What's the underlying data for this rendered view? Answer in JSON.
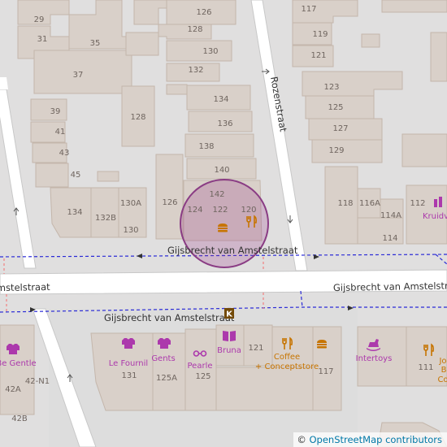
{
  "streets": {
    "rozenstraat": "Rozenstraat",
    "gijsbrecht_upper": "Gijsbrecht van Amstelstraat",
    "gijsbrecht_lower": "Gijsbrecht van Amstelstraat",
    "gijsbrecht_right": "Gijsbrecht van Amstelstraat",
    "amstelstraat_left": "Amstelstraat"
  },
  "house_numbers": {
    "n29": "29",
    "n31": "31",
    "n35": "35",
    "n37": "37",
    "n39": "39",
    "n41": "41",
    "n43": "43",
    "n45": "45",
    "n134a": "134",
    "n132b": "132B",
    "n130a": "130A",
    "n130": "130",
    "n126a": "126",
    "n128a": "128",
    "n126": "126",
    "n128": "128",
    "n130b": "130",
    "n132": "132",
    "n134": "134",
    "n136": "136",
    "n138": "138",
    "n140": "140",
    "n142": "142",
    "n124": "124",
    "n122": "122",
    "n120": "120",
    "n117": "117",
    "n119": "119",
    "n121": "121",
    "n123": "123",
    "n125": "125",
    "n127": "127",
    "n129": "129",
    "n118": "118",
    "n116a": "116A",
    "n114a": "114A",
    "n114": "114",
    "n112": "112",
    "n121b": "121",
    "n117b": "117",
    "n111": "111",
    "n131": "131",
    "n125a": "125A",
    "n42n1": "42-N1",
    "n42a": "42A",
    "n42b": "42B"
  },
  "pois": {
    "le_fournil": "Le Fournil",
    "gents": "Gents",
    "pearle": "Pearle",
    "bruna": "Bruna",
    "coffee_1": "Coffee",
    "coffee_2": "+ Conceptstore",
    "intertoys": "Intertoys",
    "be_gentle": "Be Gentle",
    "kruidvat": "Kruidv",
    "jo_1": "Jo",
    "jo_2": "B",
    "jo_3": "Co"
  },
  "icons": {
    "fast_food": "fast-food-icon",
    "restaurant": "restaurant-icon",
    "bakery": "shirt-icon",
    "clothes": "shirt-icon",
    "optician": "glasses-icon",
    "books": "book-icon",
    "cafe": "cup-icon",
    "toys": "rocking-horse-icon",
    "chemist": "chemist-icon",
    "library_k": "k-symbol-icon"
  },
  "attribution": {
    "symbol": "©",
    "text": "OpenStreetMap contributors"
  },
  "colors": {
    "building": "#d9d0c9",
    "building_edge": "#c4b6ab",
    "road": "#ffffff",
    "footway_dash": "#2b2bd6",
    "highlight_circle": "#9c3c8c",
    "poi_purple": "#ac39ac",
    "poi_orange": "#c77400"
  }
}
